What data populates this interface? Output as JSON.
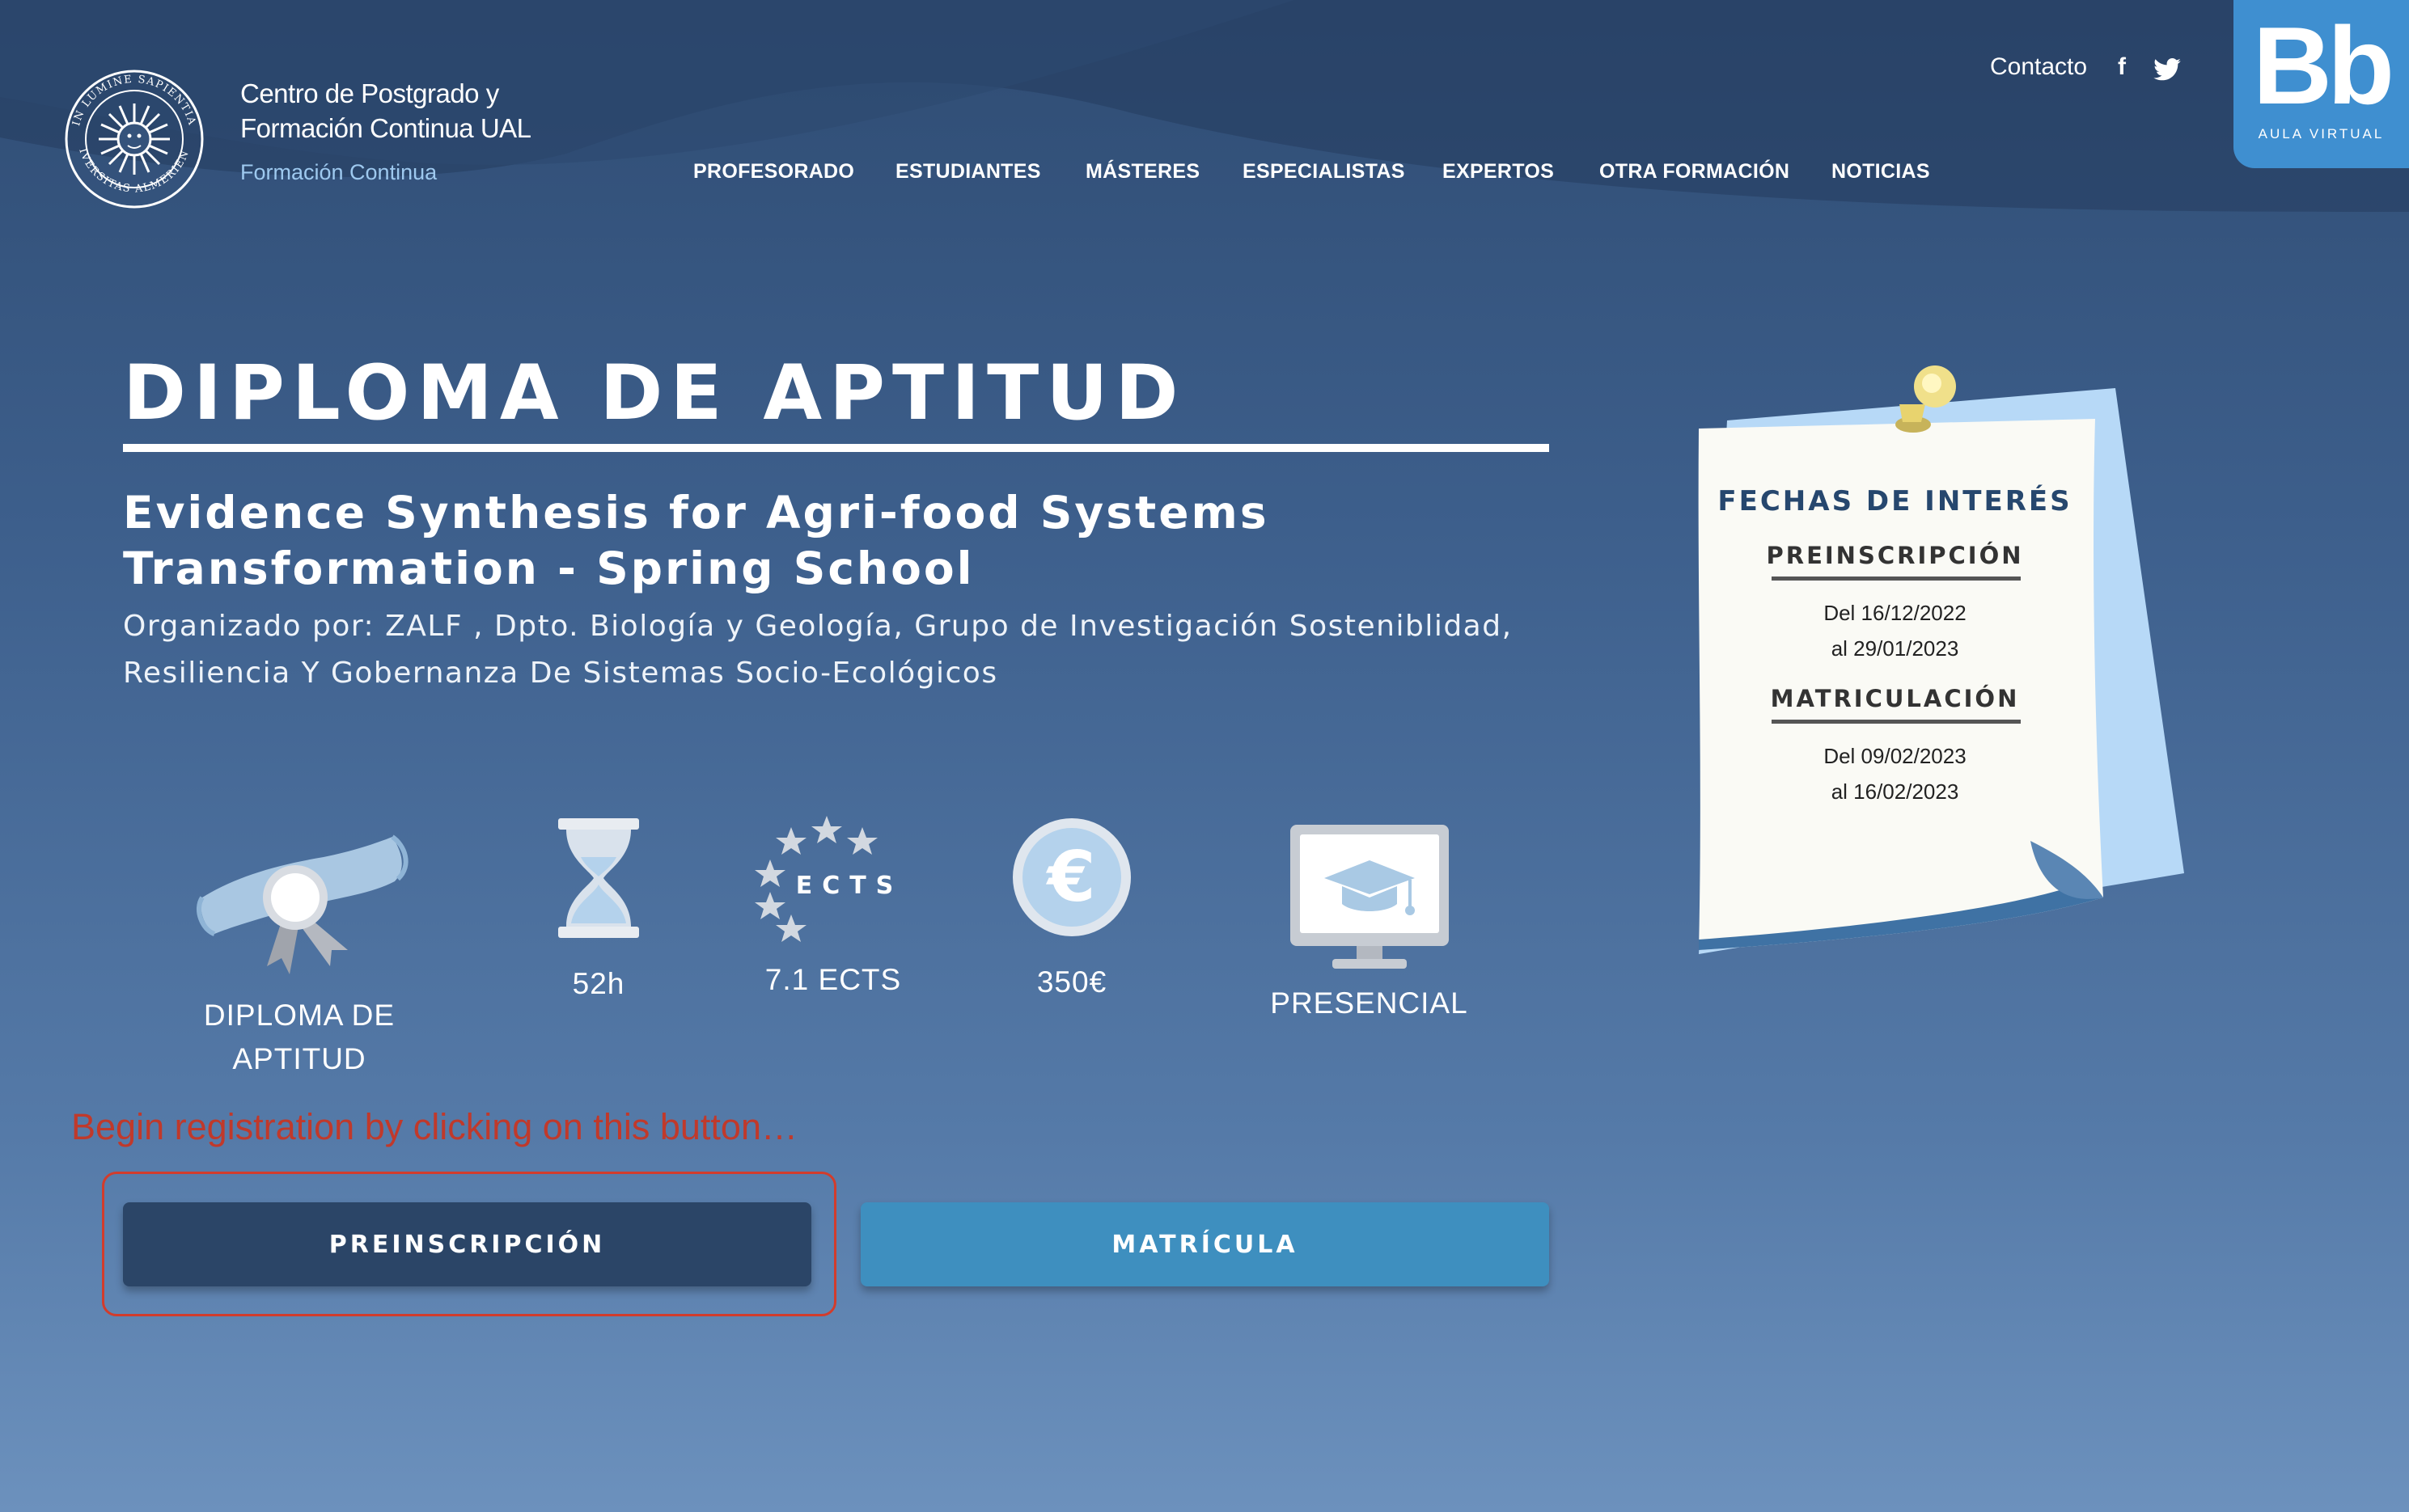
{
  "header": {
    "brand_line1": "Centro de Postgrado y",
    "brand_line2": "Formación Continua UAL",
    "brand_sub": "Formación Continua",
    "contact": "Contacto",
    "facebook_glyph": "f",
    "twitter_icon": "twitter-icon",
    "nav": [
      "PROFESORADO",
      "ESTUDIANTES",
      "MÁSTERES",
      "ESPECIALISTAS",
      "EXPERTOS",
      "OTRA FORMACIÓN",
      "NOTICIAS"
    ],
    "aula_logo": "Bb",
    "aula_label": "AULA VIRTUAL",
    "seal_top": "IN LUMINE SAPIENTIA",
    "seal_bottom": "UNIVERSITAS ALMERIENSIS"
  },
  "course": {
    "type": "DIPLOMA DE APTITUD",
    "title_line1": "Evidence Synthesis for Agri-food Systems",
    "title_line2": "Transformation - Spring School",
    "organizer_line1": "Organizado por: ZALF , Dpto. Biología y Geología, Grupo de Investigación Sosteniblidad,",
    "organizer_line2": "Resiliencia Y Gobernanza De Sistemas Socio-Ecológicos"
  },
  "features": {
    "diploma_line1": "DIPLOMA DE",
    "diploma_line2": "APTITUD",
    "hours": "52h",
    "ects_badge": "ECTS",
    "ects": "7.1 ECTS",
    "price": "350€",
    "euro_glyph": "€",
    "mode": "PRESENCIAL"
  },
  "annotation": "Begin registration by clicking on this button…",
  "buttons": {
    "preinscripcion": "PREINSCRIPCIÓN",
    "matricula": "MATRÍCULA"
  },
  "dates": {
    "heading": "FECHAS DE INTERÉS",
    "pre_label": "PREINSCRIPCIÓN",
    "pre_from": "Del 16/12/2022",
    "pre_to": "al 29/01/2023",
    "mat_label": "MATRICULACIÓN",
    "mat_from": "Del 09/02/2023",
    "mat_to": "al 16/02/2023"
  },
  "colors": {
    "background_top": "#2f4c73",
    "background_bottom": "#6c91bd",
    "primary_button": "#2b4567",
    "secondary_button": "#3e8fbf",
    "aula_virtual": "#3f8fd0",
    "annotation": "#c0392b"
  }
}
